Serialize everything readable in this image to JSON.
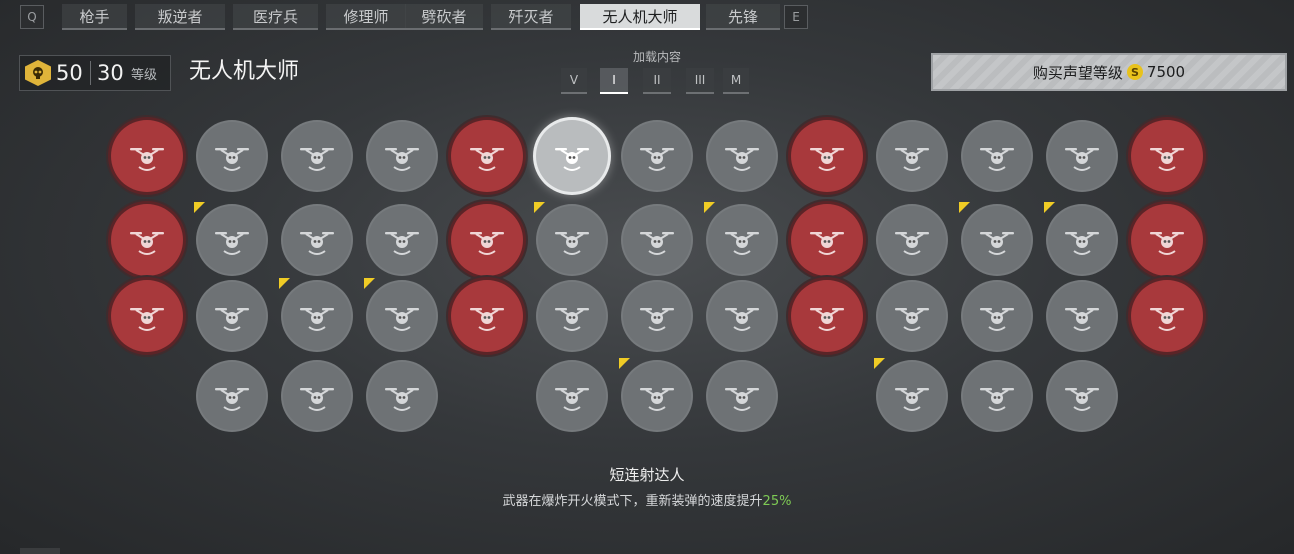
{
  "tabs": {
    "prev_key": "Q",
    "next_key": "E",
    "items": [
      {
        "label": "枪手",
        "active": false
      },
      {
        "label": "叛逆者",
        "active": false
      },
      {
        "label": "医疗兵",
        "active": false
      },
      {
        "label": "修理师",
        "active": false
      },
      {
        "label": "劈砍者",
        "active": false
      },
      {
        "label": "歼灭者",
        "active": false
      },
      {
        "label": "无人机大师",
        "active": true
      },
      {
        "label": "先锋",
        "active": false
      }
    ]
  },
  "header": {
    "prestige": "50",
    "level": "30",
    "level_label": "等级",
    "class_title": "无人机大师",
    "badge_icon": "skull-hex-icon"
  },
  "loadout": {
    "label": "加载内容",
    "slots": [
      "V",
      "I",
      "II",
      "III",
      "M"
    ],
    "active_slot": "I"
  },
  "buy": {
    "label": "购买声望等级",
    "currency_icon": "coin-s-icon",
    "price": "7500"
  },
  "perks": {
    "rows": [
      [
        "red",
        "gray",
        "gray",
        "gray",
        "red",
        "sel",
        "gray",
        "gray",
        "red",
        "gray",
        "gray",
        "gray",
        "red"
      ],
      [
        "red",
        "gray",
        "gray",
        "gray",
        "red",
        "gray",
        "gray",
        "gray",
        "red",
        "gray",
        "gray",
        "gray",
        "red"
      ],
      [
        "red",
        "gray",
        "gray",
        "gray",
        "red",
        "gray",
        "gray",
        "gray",
        "red",
        "gray",
        "gray",
        "gray",
        "red"
      ],
      [
        "none",
        "gray",
        "gray",
        "gray",
        "none",
        "gray",
        "gray",
        "gray",
        "none",
        "gray",
        "gray",
        "gray",
        "none"
      ]
    ],
    "new_marks": [
      [
        1,
        1
      ],
      [
        1,
        5
      ],
      [
        1,
        7
      ],
      [
        1,
        10
      ],
      [
        1,
        11
      ],
      [
        2,
        2
      ],
      [
        2,
        3
      ],
      [
        3,
        6
      ],
      [
        3,
        9
      ]
    ],
    "selected": [
      0,
      5
    ],
    "icons": "drone-perk-icon"
  },
  "description": {
    "title": "短连射达人",
    "text": "武器在爆炸开火模式下，重新装弹的速度提升",
    "value": "25%"
  },
  "colors": {
    "red_perk": "#a8393c",
    "gray_perk": "#6e7275",
    "new_mark": "#f0cc25",
    "highlight_value": "#7ecb55"
  }
}
